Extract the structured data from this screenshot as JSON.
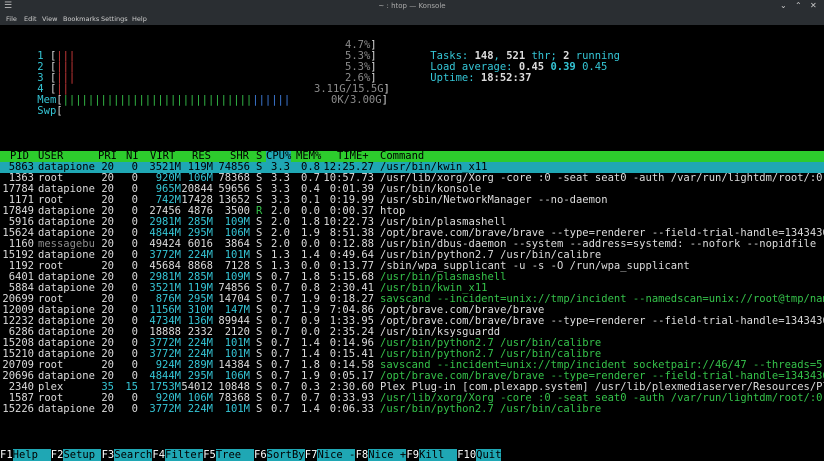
{
  "window": {
    "title": "~ : htop — Konsole",
    "minimize": "⌄",
    "maximize": "⌃",
    "close": "✕"
  },
  "menu": [
    "File",
    "Edit",
    "View",
    "Bookmarks",
    "Settings",
    "Help"
  ],
  "cpu": [
    {
      "label": "1",
      "percent": "4.7%",
      "bars": "|||"
    },
    {
      "label": "2",
      "percent": "5.3%",
      "bars": "|||"
    },
    {
      "label": "3",
      "percent": "5.3%",
      "bars": "|||"
    },
    {
      "label": "4",
      "percent": "2.6%",
      "bars": "||"
    }
  ],
  "mem": {
    "label": "Mem",
    "value": "3.11G/15.5G",
    "bars": "||||||||||||||||||||||||||||||"
  },
  "swp": {
    "label": "Swp",
    "value": "0K/3.00G"
  },
  "summary": {
    "tasks_label": "Tasks: ",
    "tasks": "148",
    "thr_sep": ", ",
    "threads": "521",
    "thr_label": " thr; ",
    "running": "2",
    "running_label": " running",
    "load_label": "Load average: ",
    "load1": "0.45",
    "load5": "0.39",
    "load15": "0.45",
    "uptime_label": "Uptime: ",
    "uptime": "18:52:37"
  },
  "columns": [
    "PID",
    "USER",
    "PRI",
    "NI",
    "VIRT",
    "RES",
    "SHR",
    "S",
    "CPU%",
    "MEM%",
    "TIME+",
    "Command"
  ],
  "processes": [
    {
      "pid": "5863",
      "user": "datapione",
      "pri": "20",
      "ni": "0",
      "virt": "3521M",
      "res": "119M",
      "shr": "74856",
      "s": "S",
      "cpu": "3.3",
      "mem": "0.8",
      "time": "12:25.27",
      "cmd": "/usr/bin/kwin_x11",
      "ctype": "thread"
    },
    {
      "pid": "1363",
      "user": "root",
      "pri": "20",
      "ni": "0",
      "virt": "920M",
      "res": "106M",
      "shr": "78368",
      "s": "S",
      "cpu": "3.3",
      "mem": "0.7",
      "time": "10:57.73",
      "cmd": "/usr/lib/xorg/Xorg -core :0 -seat seat0 -auth /var/run/lightdm/root/:0 -",
      "ctype": "normal"
    },
    {
      "pid": "17784",
      "user": "datapione",
      "pri": "20",
      "ni": "0",
      "virt": "965M",
      "res": "20844",
      "shr": "59656",
      "s": "S",
      "cpu": "3.3",
      "mem": "0.4",
      "time": "0:01.39",
      "cmd": "/usr/bin/konsole",
      "ctype": "normal"
    },
    {
      "pid": "1171",
      "user": "root",
      "pri": "20",
      "ni": "0",
      "virt": "742M",
      "res": "17428",
      "shr": "13652",
      "s": "S",
      "cpu": "3.3",
      "mem": "0.1",
      "time": "0:19.99",
      "cmd": "/usr/sbin/NetworkManager --no-daemon",
      "ctype": "normal"
    },
    {
      "pid": "17849",
      "user": "datapione",
      "pri": "20",
      "ni": "0",
      "virt": "27456",
      "res": "4876",
      "shr": "3500",
      "s": "R",
      "cpu": "2.0",
      "mem": "0.0",
      "time": "0:00.37",
      "cmd": "htop",
      "ctype": "normal"
    },
    {
      "pid": "5916",
      "user": "datapione",
      "pri": "20",
      "ni": "0",
      "virt": "2981M",
      "res": "285M",
      "shr": "109M",
      "s": "S",
      "cpu": "2.0",
      "mem": "1.8",
      "time": "10:22.73",
      "cmd": "/usr/bin/plasmashell",
      "ctype": "normal"
    },
    {
      "pid": "15624",
      "user": "datapione",
      "pri": "20",
      "ni": "0",
      "virt": "4844M",
      "res": "295M",
      "shr": "106M",
      "s": "S",
      "cpu": "2.0",
      "mem": "1.9",
      "time": "8:51.38",
      "cmd": "/opt/brave.com/brave/brave --type=renderer --field-trial-handle=13434367",
      "ctype": "normal"
    },
    {
      "pid": "1160",
      "user": "messagebu",
      "pri": "20",
      "ni": "0",
      "virt": "49424",
      "res": "6016",
      "shr": "3864",
      "s": "S",
      "cpu": "2.0",
      "mem": "0.0",
      "time": "0:12.88",
      "cmd": "/usr/bin/dbus-daemon --system --address=systemd: --nofork --nopidfile --",
      "ctype": "normal"
    },
    {
      "pid": "15192",
      "user": "datapione",
      "pri": "20",
      "ni": "0",
      "virt": "3772M",
      "res": "224M",
      "shr": "101M",
      "s": "S",
      "cpu": "1.3",
      "mem": "1.4",
      "time": "0:49.64",
      "cmd": "/usr/bin/python2.7 /usr/bin/calibre",
      "ctype": "normal"
    },
    {
      "pid": "1192",
      "user": "root",
      "pri": "20",
      "ni": "0",
      "virt": "45684",
      "res": "8868",
      "shr": "7128",
      "s": "S",
      "cpu": "1.3",
      "mem": "0.0",
      "time": "0:13.77",
      "cmd": "/sbin/wpa_supplicant -u -s -O /run/wpa_supplicant",
      "ctype": "normal"
    },
    {
      "pid": "6401",
      "user": "datapione",
      "pri": "20",
      "ni": "0",
      "virt": "2981M",
      "res": "285M",
      "shr": "109M",
      "s": "S",
      "cpu": "0.7",
      "mem": "1.8",
      "time": "5:15.68",
      "cmd": "/usr/bin/plasmashell",
      "ctype": "thread"
    },
    {
      "pid": "5884",
      "user": "datapione",
      "pri": "20",
      "ni": "0",
      "virt": "3521M",
      "res": "119M",
      "shr": "74856",
      "s": "S",
      "cpu": "0.7",
      "mem": "0.8",
      "time": "2:30.41",
      "cmd": "/usr/bin/kwin_x11",
      "ctype": "thread"
    },
    {
      "pid": "20699",
      "user": "root",
      "pri": "20",
      "ni": "0",
      "virt": "876M",
      "res": "295M",
      "shr": "14704",
      "s": "S",
      "cpu": "0.7",
      "mem": "1.9",
      "time": "0:18.27",
      "cmd": "savscand --incident=unix://tmp/incident --namedscan=unix://root@tmp/name",
      "ctype": "thread"
    },
    {
      "pid": "12009",
      "user": "datapione",
      "pri": "20",
      "ni": "0",
      "virt": "1156M",
      "res": "310M",
      "shr": "147M",
      "s": "S",
      "cpu": "0.7",
      "mem": "1.9",
      "time": "7:04.86",
      "cmd": "/opt/brave.com/brave/brave",
      "ctype": "normal"
    },
    {
      "pid": "12232",
      "user": "datapione",
      "pri": "20",
      "ni": "0",
      "virt": "4734M",
      "res": "136M",
      "shr": "89944",
      "s": "S",
      "cpu": "0.7",
      "mem": "0.9",
      "time": "1:33.95",
      "cmd": "/opt/brave.com/brave/brave --type=renderer --field-trial-handle=13434367",
      "ctype": "normal"
    },
    {
      "pid": "6286",
      "user": "datapione",
      "pri": "20",
      "ni": "0",
      "virt": "18888",
      "res": "2332",
      "shr": "2120",
      "s": "S",
      "cpu": "0.7",
      "mem": "0.0",
      "time": "2:35.24",
      "cmd": "/usr/bin/ksysguardd",
      "ctype": "normal"
    },
    {
      "pid": "15208",
      "user": "datapione",
      "pri": "20",
      "ni": "0",
      "virt": "3772M",
      "res": "224M",
      "shr": "101M",
      "s": "S",
      "cpu": "0.7",
      "mem": "1.4",
      "time": "0:14.96",
      "cmd": "/usr/bin/python2.7 /usr/bin/calibre",
      "ctype": "thread"
    },
    {
      "pid": "15210",
      "user": "datapione",
      "pri": "20",
      "ni": "0",
      "virt": "3772M",
      "res": "224M",
      "shr": "101M",
      "s": "S",
      "cpu": "0.7",
      "mem": "1.4",
      "time": "0:15.41",
      "cmd": "/usr/bin/python2.7 /usr/bin/calibre",
      "ctype": "thread"
    },
    {
      "pid": "20709",
      "user": "root",
      "pri": "20",
      "ni": "0",
      "virt": "924M",
      "res": "289M",
      "shr": "14384",
      "s": "S",
      "cpu": "0.7",
      "mem": "1.8",
      "time": "0:14.58",
      "cmd": "savscand --incident=unix://tmp/incident socketpair://46/47 --threads=5",
      "ctype": "thread"
    },
    {
      "pid": "20696",
      "user": "datapione",
      "pri": "20",
      "ni": "0",
      "virt": "4844M",
      "res": "295M",
      "shr": "106M",
      "s": "S",
      "cpu": "0.7",
      "mem": "1.9",
      "time": "0:05.17",
      "cmd": "/opt/brave.com/brave/brave --type=renderer --field-trial-handle=13434367",
      "ctype": "thread"
    },
    {
      "pid": "2340",
      "user": "plex",
      "pri": "35",
      "ni": "15",
      "virt": "1753M",
      "res": "54012",
      "shr": "10848",
      "s": "S",
      "cpu": "0.7",
      "mem": "0.3",
      "time": "2:30.60",
      "cmd": "Plex Plug-in [com.plexapp.system] /usr/lib/plexmediaserver/Resources/Plu",
      "ctype": "normal"
    },
    {
      "pid": "1587",
      "user": "root",
      "pri": "20",
      "ni": "0",
      "virt": "920M",
      "res": "106M",
      "shr": "78368",
      "s": "S",
      "cpu": "0.7",
      "mem": "0.7",
      "time": "0:33.93",
      "cmd": "/usr/lib/xorg/Xorg -core :0 -seat seat0 -auth /var/run/lightdm/root/:0 -",
      "ctype": "thread"
    },
    {
      "pid": "15226",
      "user": "datapione",
      "pri": "20",
      "ni": "0",
      "virt": "3772M",
      "res": "224M",
      "shr": "101M",
      "s": "S",
      "cpu": "0.7",
      "mem": "1.4",
      "time": "0:06.33",
      "cmd": "/usr/bin/python2.7 /usr/bin/calibre",
      "ctype": "thread"
    }
  ],
  "fkeys": [
    {
      "key": "F1",
      "label": "Help  "
    },
    {
      "key": "F2",
      "label": "Setup "
    },
    {
      "key": "F3",
      "label": "Search"
    },
    {
      "key": "F4",
      "label": "Filter"
    },
    {
      "key": "F5",
      "label": "Tree  "
    },
    {
      "key": "F6",
      "label": "SortBy"
    },
    {
      "key": "F7",
      "label": "Nice -"
    },
    {
      "key": "F8",
      "label": "Nice +"
    },
    {
      "key": "F9",
      "label": "Kill  "
    },
    {
      "key": "F10",
      "label": "Quit"
    }
  ],
  "colors": {
    "header_bg": "#2dcc2d",
    "selected_bg": "#1fa7b4",
    "accent_cyan": "#35c6d6",
    "thread_green": "#35c24a"
  }
}
